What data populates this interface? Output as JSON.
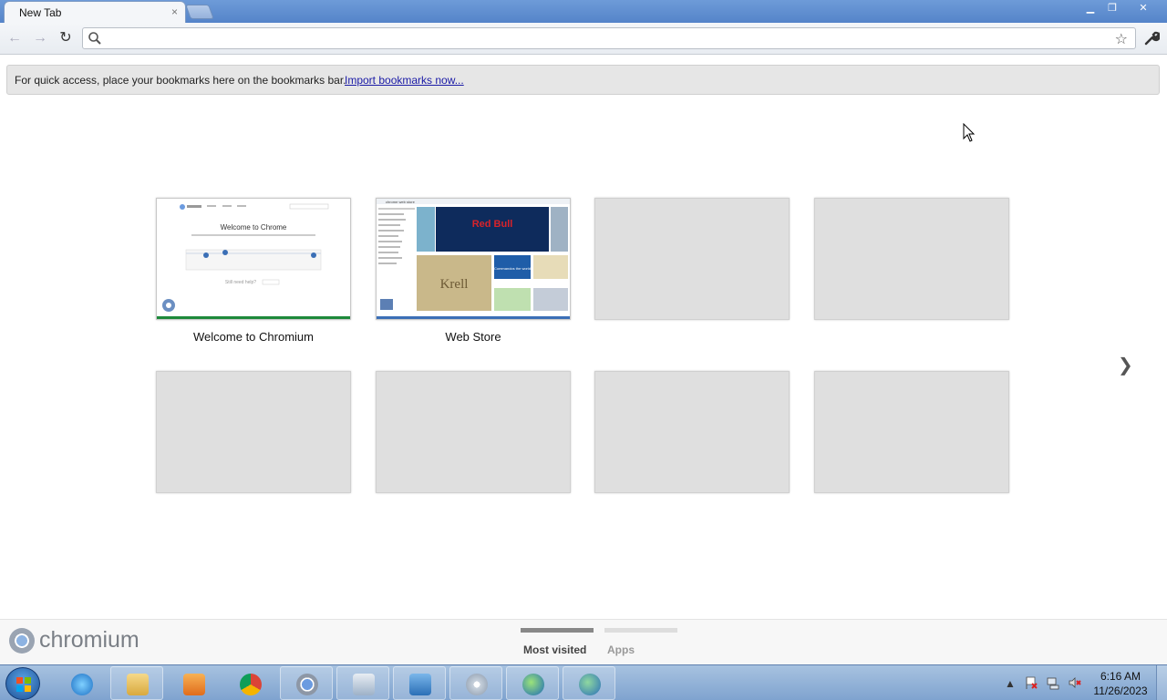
{
  "tab": {
    "title": "New Tab",
    "close_glyph": "×"
  },
  "window_controls": {
    "minimize": "▁",
    "maximize": "❐",
    "close": "✕"
  },
  "toolbar": {
    "back_glyph": "←",
    "forward_glyph": "→",
    "reload_glyph": "↻",
    "omnibox_value": "",
    "star_glyph": "☆",
    "wrench_glyph": "🔧"
  },
  "bookmarks_bar": {
    "text": "For quick access, place your bookmarks here on the bookmarks bar.",
    "link": "Import bookmarks now..."
  },
  "most_visited": {
    "tiles": [
      {
        "title": "Welcome to Chromium",
        "filled": true,
        "accent": "#1d8a3a"
      },
      {
        "title": "Web Store",
        "filled": true,
        "accent": "#3b6fb6"
      },
      {
        "title": "",
        "filled": false
      },
      {
        "title": "",
        "filled": false
      },
      {
        "title": "",
        "filled": false
      },
      {
        "title": "",
        "filled": false
      },
      {
        "title": "",
        "filled": false
      },
      {
        "title": "",
        "filled": false
      }
    ],
    "thumb_welcome": {
      "heading": "Welcome to Chrome",
      "footer": "Still need help?"
    },
    "thumb_store": {
      "title": "chrome web store",
      "banner": "Red Bull",
      "tile_b": "Krell",
      "tile_c": "Commandos the world"
    },
    "next_glyph": "❯"
  },
  "footer": {
    "brand": "chromium",
    "tab_most_visited": "Most visited",
    "tab_apps": "Apps",
    "active_color": "#888888",
    "inactive_color": "#dddddd"
  },
  "taskbar": {
    "time": "6:16 AM",
    "date": "11/26/2023",
    "apps": [
      "internet-explorer",
      "file-explorer",
      "media-player",
      "chrome",
      "chromium",
      "calendar-tool",
      "control-panel",
      "disc-burner",
      "network-globe",
      "globe-checklist"
    ]
  }
}
